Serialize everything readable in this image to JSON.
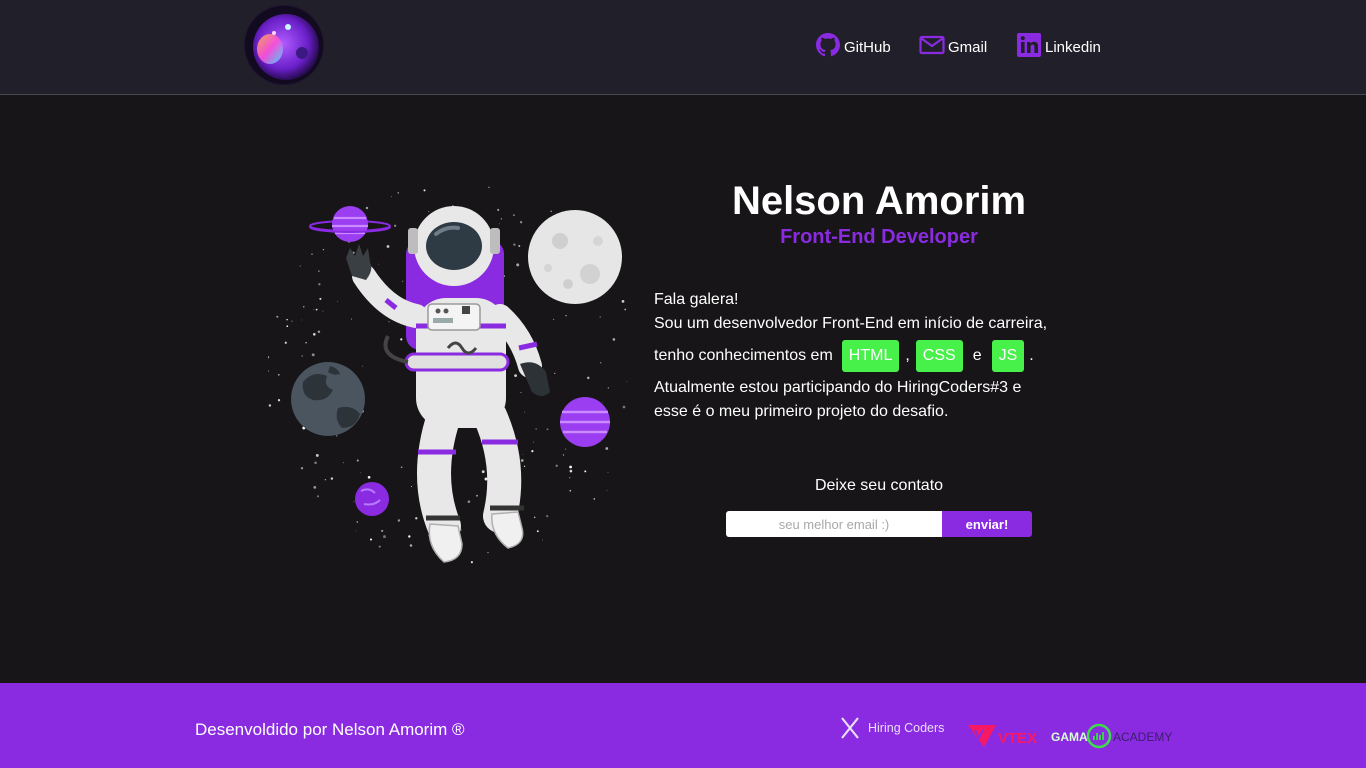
{
  "header": {
    "nav": [
      {
        "label": "GitHub",
        "icon": "github-icon"
      },
      {
        "label": "Gmail",
        "icon": "mail-icon"
      },
      {
        "label": "Linkedin",
        "icon": "linkedin-icon"
      }
    ]
  },
  "hero": {
    "name": "Nelson Amorim",
    "role": "Front-End Developer",
    "bio": {
      "line1": "Fala galera!",
      "line2": "Sou um desenvolvedor Front-End em início de carreira,",
      "line3_prefix": "tenho conhecimentos em",
      "techs": [
        "HTML",
        "CSS",
        "JS"
      ],
      "sep_comma": ",",
      "sep_and": "e",
      "end_period": ".",
      "line4": "Atualmente estou participando do HiringCoders#3 e",
      "line5": "esse é o meu primeiro projeto do desafio."
    }
  },
  "contact": {
    "title": "Deixe seu contato",
    "placeholder": "seu melhor email :)",
    "button_label": "enviar!"
  },
  "footer": {
    "credit": "Desenvoldido por Nelson Amorim ®",
    "logos": {
      "hiring_coders": "Hiring Coders",
      "vtex": "VTEX",
      "gama": "GAMA",
      "academy": "ACADEMY"
    }
  },
  "colors": {
    "accent": "#8a2be2",
    "tag_green": "#48f04a",
    "background": "#171517",
    "header_bg": "#211f29"
  }
}
